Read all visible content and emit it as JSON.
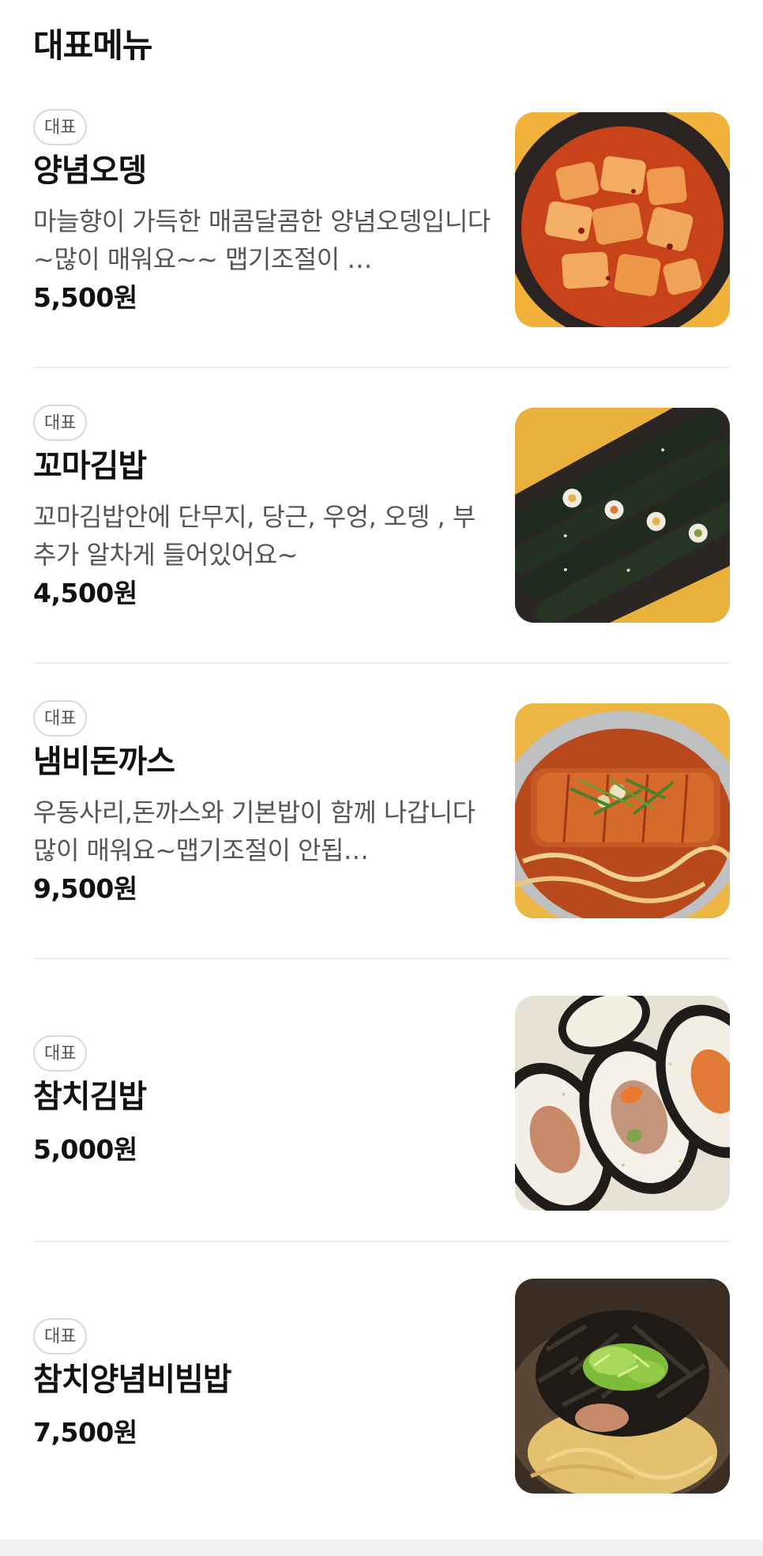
{
  "section": {
    "title": "대표메뉴"
  },
  "menu": {
    "items": [
      {
        "badge": "대표",
        "name": "양념오뎅",
        "description": "마늘향이 가득한 매콤달콤한 양념오뎅입니다~많이 매워요~~ 맵기조절이 …",
        "price": "5,500원",
        "photo": "spicy-fishcake-photo"
      },
      {
        "badge": "대표",
        "name": "꼬마김밥",
        "description": "꼬마김밥안에 단무지, 당근, 우엉, 오뎅 , 부추가 알차게 들어있어요~",
        "price": "4,500원",
        "photo": "mini-gimbap-photo"
      },
      {
        "badge": "대표",
        "name": "냄비돈까스",
        "description": "우동사리,돈까스와 기본밥이 함께 나갑니다 많이 매워요~맵기조절이 안됩…",
        "price": "9,500원",
        "photo": "pot-tonkatsu-photo"
      },
      {
        "badge": "대표",
        "name": "참치김밥",
        "price": "5,000원",
        "photo": "tuna-gimbap-photo"
      },
      {
        "badge": "대표",
        "name": "참치양념비빔밥",
        "price": "7,500원",
        "photo": "tuna-bibimbap-photo"
      }
    ]
  },
  "colors": {
    "background": "#ffffff",
    "divider": "#eeeeee",
    "badge_border": "#d9d9d9",
    "text_primary": "#111111",
    "text_secondary": "#555555"
  }
}
